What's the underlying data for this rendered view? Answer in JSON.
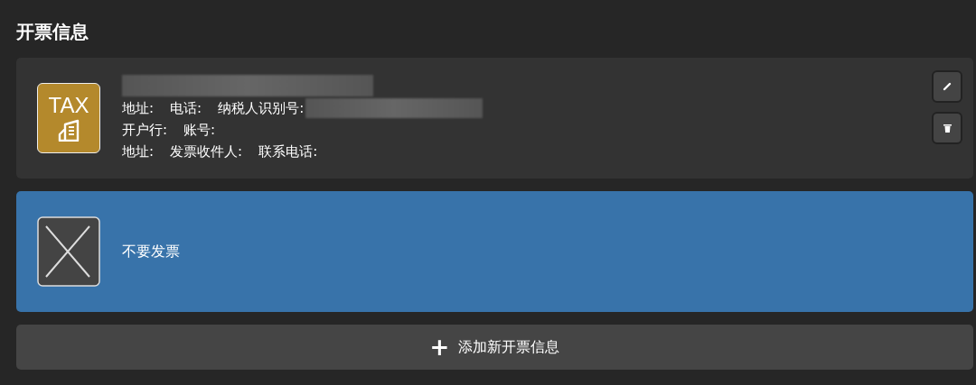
{
  "section_title": "开票信息",
  "options": [
    {
      "kind": "tax",
      "selected": false,
      "badge": "TAX",
      "lines": [
        [
          "地址:",
          "电话:",
          "纳税人识别号:"
        ],
        [
          "开户行:",
          "账号:"
        ],
        [
          "地址:",
          "发票收件人:",
          "联系电话:"
        ]
      ]
    },
    {
      "kind": "none",
      "selected": true,
      "label": "不要发票"
    }
  ],
  "add_button": {
    "icon": "+",
    "label": "添加新开票信息"
  }
}
